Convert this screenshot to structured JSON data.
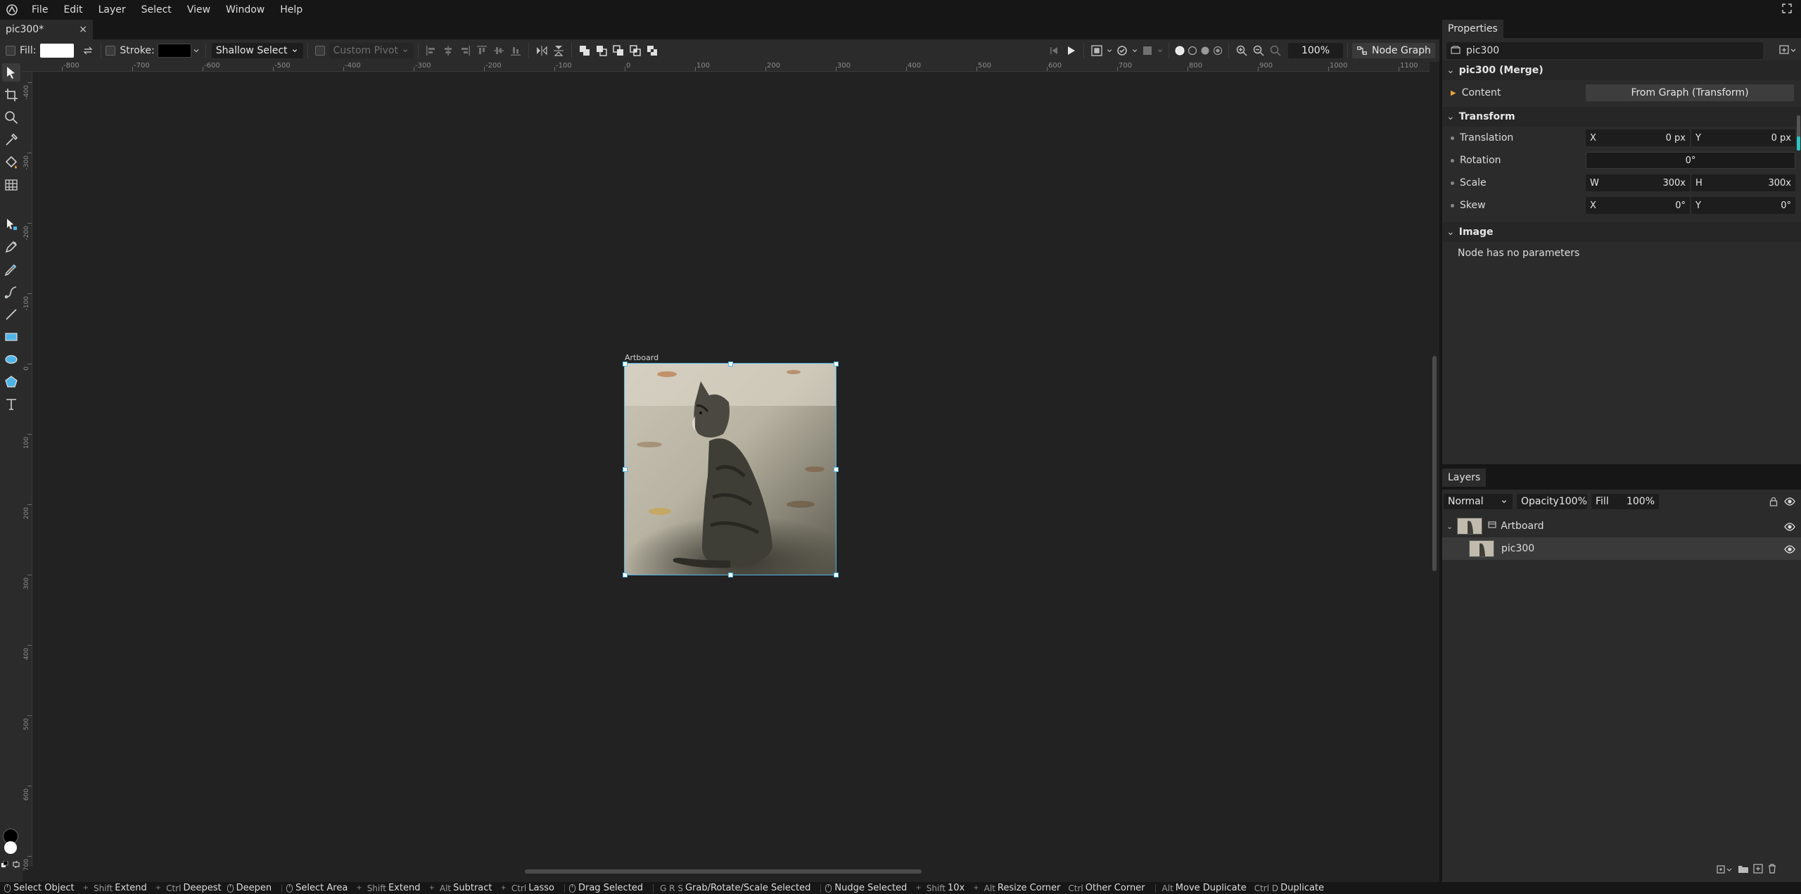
{
  "menubar": {
    "items": [
      "File",
      "Edit",
      "Layer",
      "Select",
      "View",
      "Window",
      "Help"
    ]
  },
  "tabs": {
    "document": "pic300*",
    "close_glyph": "×"
  },
  "options": {
    "fill_label": "Fill:",
    "fill_color": "#ffffff",
    "stroke_label": "Stroke:",
    "stroke_color": "#000000",
    "select_mode": "Shallow Select",
    "pivot": "Custom Pivot",
    "zoom": "100%",
    "node_graph": "Node Graph"
  },
  "ruler": {
    "top_labels": [
      "-800",
      "-700",
      "-600",
      "-500",
      "-400",
      "-300",
      "-200",
      "-100",
      "0",
      "100",
      "200",
      "300",
      "400",
      "500",
      "600",
      "700",
      "800",
      "900",
      "1000",
      "1100"
    ],
    "left_labels": [
      "-400",
      "-300",
      "-200",
      "-100",
      "0",
      "100",
      "200",
      "300",
      "400",
      "500",
      "600",
      "700"
    ]
  },
  "canvas": {
    "artboard_label": "Artboard"
  },
  "properties": {
    "tab": "Properties",
    "search_value": "pic300",
    "node_title": "pic300 (Merge)",
    "content_label": "Content",
    "content_value": "From Graph (Transform)",
    "transform": {
      "title": "Transform",
      "translation": {
        "label": "Translation",
        "x_axis": "X",
        "x": "0 px",
        "y_axis": "Y",
        "y": "0 px"
      },
      "rotation": {
        "label": "Rotation",
        "value": "0°"
      },
      "scale": {
        "label": "Scale",
        "w_axis": "W",
        "w": "300x",
        "h_axis": "H",
        "h": "300x"
      },
      "skew": {
        "label": "Skew",
        "x_axis": "X",
        "x": "0°",
        "y_axis": "Y",
        "y": "0°"
      }
    },
    "image": {
      "title": "Image",
      "note": "Node has no parameters"
    }
  },
  "layers": {
    "tab": "Layers",
    "blend": "Normal",
    "opacity_label": "Opacity",
    "opacity": "100%",
    "fill_label": "Fill",
    "fill": "100%",
    "items": [
      {
        "name": "Artboard"
      },
      {
        "name": "pic300"
      }
    ]
  },
  "statusbar": {
    "items": [
      {
        "keys": "",
        "label": "Select Object"
      },
      {
        "keys": "Shift",
        "label": "Extend"
      },
      {
        "keys": "Ctrl",
        "label": "Deepest"
      },
      {
        "keys": "",
        "label": "Deepen"
      },
      {
        "keys": "",
        "label": "Select Area"
      },
      {
        "keys": "Shift",
        "label": "Extend"
      },
      {
        "keys": "Alt",
        "label": "Subtract"
      },
      {
        "keys": "Ctrl",
        "label": "Lasso"
      },
      {
        "keys": "",
        "label": "Drag Selected"
      },
      {
        "keys": "G R S",
        "label": "Grab/Rotate/Scale Selected"
      },
      {
        "keys": "",
        "label": "Nudge Selected"
      },
      {
        "keys": "Shift",
        "label": "10x"
      },
      {
        "keys": "Alt",
        "label": "Resize Corner"
      },
      {
        "keys": "Ctrl",
        "label": "Other Corner"
      },
      {
        "keys": "Alt",
        "label": "Move Duplicate"
      },
      {
        "keys": "Ctrl D",
        "label": "Duplicate"
      }
    ]
  },
  "colors": {
    "accent": "#4fb5e8",
    "panel": "#2b2b2b",
    "canvas": "#222222"
  }
}
